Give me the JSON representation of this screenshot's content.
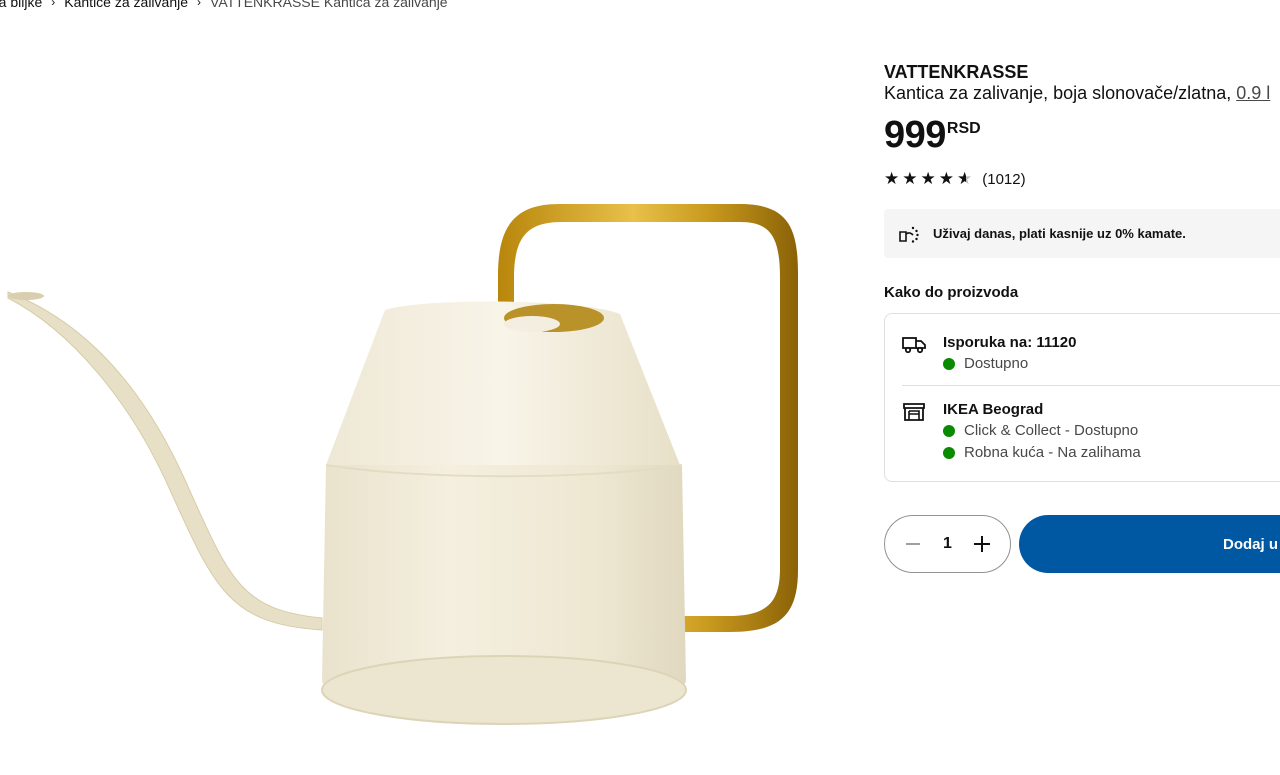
{
  "breadcrumb": {
    "items": [
      "Posude za biljke",
      "Kantice za zalivanje"
    ],
    "first_visible": "e za biljke",
    "current": "VATTENKRASSE Kantica za zalivanje"
  },
  "product": {
    "name": "VATTENKRASSE",
    "description": "Kantica za zalivanje, boja slonovače/zlatna, ",
    "size_link": "0.9 l",
    "price": "999",
    "currency": "RSD",
    "rating": 4.5,
    "reviews": "(1012)",
    "image_icon": "watering-can-image"
  },
  "promo": {
    "icon": "installment-icon",
    "text": "Uživaj danas, plati kasnije uz 0% kamate."
  },
  "availability": {
    "title": "Kako do proizvoda",
    "delivery": {
      "icon": "truck-icon",
      "title": "Isporuka na: 11120",
      "status": "Dostupno"
    },
    "store": {
      "icon": "store-icon",
      "title": "IKEA Beograd",
      "status1": "Click & Collect - Dostupno",
      "status2": "Robna kuća - Na zalihama"
    },
    "status_color": "#0a8a00"
  },
  "cart": {
    "quantity": "1",
    "add_label": "Dodaj u korpu",
    "accent": "#0058a3"
  }
}
